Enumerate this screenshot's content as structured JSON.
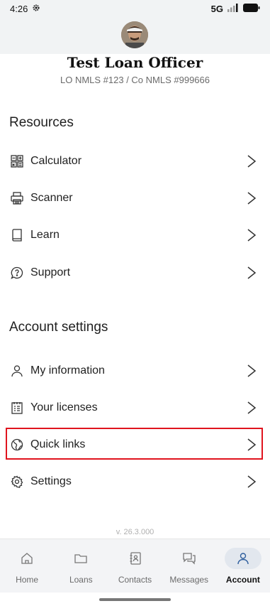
{
  "status_bar": {
    "time": "4:26",
    "network": "5G"
  },
  "profile": {
    "name": "Test Loan Officer",
    "subtitle": "LO NMLS #123 / Co NMLS #999666"
  },
  "resources": {
    "title": "Resources",
    "items": [
      {
        "label": "Calculator",
        "icon": "calculator-icon"
      },
      {
        "label": "Scanner",
        "icon": "scanner-icon"
      },
      {
        "label": "Learn",
        "icon": "book-icon"
      },
      {
        "label": "Support",
        "icon": "support-icon"
      }
    ]
  },
  "account_settings": {
    "title": "Account settings",
    "items": [
      {
        "label": "My information",
        "icon": "person-icon"
      },
      {
        "label": "Your licenses",
        "icon": "license-icon"
      },
      {
        "label": "Quick links",
        "icon": "globe-icon"
      },
      {
        "label": "Settings",
        "icon": "gear-icon"
      }
    ]
  },
  "version": "v. 26.3.000",
  "bottom_nav": {
    "items": [
      {
        "label": "Home",
        "icon": "home-icon"
      },
      {
        "label": "Loans",
        "icon": "folder-icon"
      },
      {
        "label": "Contacts",
        "icon": "contacts-icon"
      },
      {
        "label": "Messages",
        "icon": "messages-icon"
      },
      {
        "label": "Account",
        "icon": "account-icon"
      }
    ],
    "active": "Account"
  },
  "colors": {
    "highlight": "#e0141e",
    "active_nav_bg": "#e2e7ee"
  }
}
